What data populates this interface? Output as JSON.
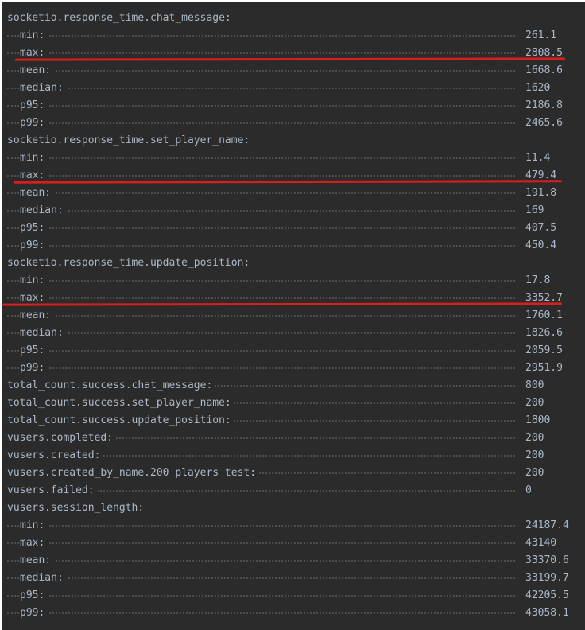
{
  "colors": {
    "background": "#2b2b2b",
    "text": "#a9b7c6",
    "dots": "#4e4e4e",
    "annotation_underline": "#d91e1e"
  },
  "lines": [
    {
      "kind": "head",
      "label": "socketio.response_time.chat_message:",
      "value": null
    },
    {
      "kind": "sub",
      "label": "min:",
      "value": "261.1"
    },
    {
      "kind": "sub",
      "label": "max:",
      "value": "2808.5"
    },
    {
      "kind": "sub",
      "label": "mean:",
      "value": "1668.6"
    },
    {
      "kind": "sub",
      "label": "median:",
      "value": "1620"
    },
    {
      "kind": "sub",
      "label": "p95:",
      "value": "2186.8"
    },
    {
      "kind": "sub",
      "label": "p99:",
      "value": "2465.6"
    },
    {
      "kind": "head",
      "label": "socketio.response_time.set_player_name:",
      "value": null
    },
    {
      "kind": "sub",
      "label": "min:",
      "value": "11.4"
    },
    {
      "kind": "sub",
      "label": "max:",
      "value": "479.4"
    },
    {
      "kind": "sub",
      "label": "mean:",
      "value": "191.8"
    },
    {
      "kind": "sub",
      "label": "median:",
      "value": "169"
    },
    {
      "kind": "sub",
      "label": "p95:",
      "value": "407.5"
    },
    {
      "kind": "sub",
      "label": "p99:",
      "value": "450.4"
    },
    {
      "kind": "head",
      "label": "socketio.response_time.update_position:",
      "value": null
    },
    {
      "kind": "sub",
      "label": "min:",
      "value": "17.8"
    },
    {
      "kind": "sub",
      "label": "max:",
      "value": "3352.7"
    },
    {
      "kind": "sub",
      "label": "mean:",
      "value": "1760.1"
    },
    {
      "kind": "sub",
      "label": "median:",
      "value": "1826.6"
    },
    {
      "kind": "sub",
      "label": "p95:",
      "value": "2059.5"
    },
    {
      "kind": "sub",
      "label": "p99:",
      "value": "2951.9"
    },
    {
      "kind": "head",
      "label": "total_count.success.chat_message:",
      "value": "800"
    },
    {
      "kind": "head",
      "label": "total_count.success.set_player_name:",
      "value": "200"
    },
    {
      "kind": "head",
      "label": "total_count.success.update_position:",
      "value": "1800"
    },
    {
      "kind": "head",
      "label": "vusers.completed:",
      "value": "200"
    },
    {
      "kind": "head",
      "label": "vusers.created:",
      "value": "200"
    },
    {
      "kind": "head",
      "label": "vusers.created_by_name.200 players test:",
      "value": "200"
    },
    {
      "kind": "head",
      "label": "vusers.failed:",
      "value": "0"
    },
    {
      "kind": "head",
      "label": "vusers.session_length:",
      "value": null
    },
    {
      "kind": "sub",
      "label": "min:",
      "value": "24187.4"
    },
    {
      "kind": "sub",
      "label": "max:",
      "value": "43140"
    },
    {
      "kind": "sub",
      "label": "mean:",
      "value": "33370.6"
    },
    {
      "kind": "sub",
      "label": "median:",
      "value": "33199.7"
    },
    {
      "kind": "sub",
      "label": "p95:",
      "value": "42205.5"
    },
    {
      "kind": "sub",
      "label": "p99:",
      "value": "43058.1"
    }
  ]
}
